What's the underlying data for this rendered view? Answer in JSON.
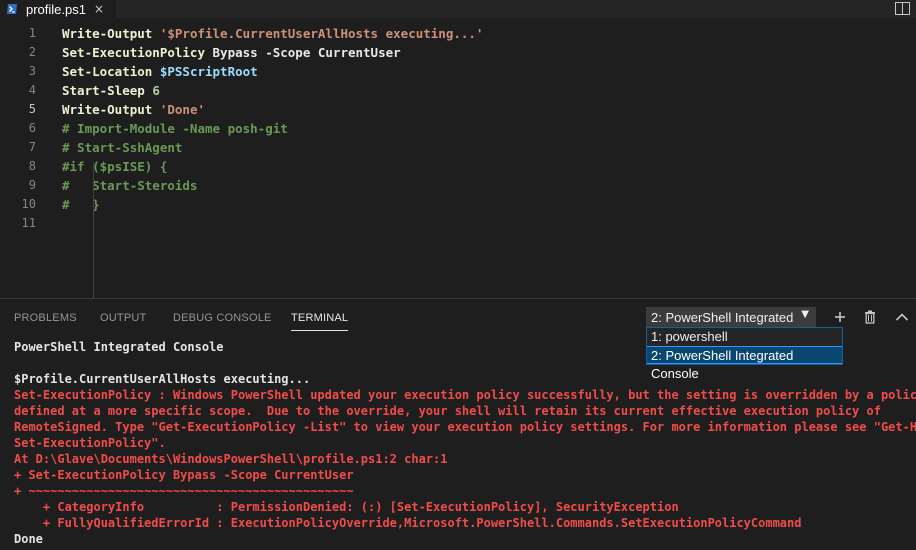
{
  "tab": {
    "filename": "profile.ps1",
    "close": "×"
  },
  "editor": {
    "lines": [
      {
        "num": "1",
        "tokens": [
          {
            "c": "cmd",
            "t": "Write-Output "
          },
          {
            "c": "str",
            "t": "'$Profile.CurrentUserAllHosts executing...'"
          }
        ]
      },
      {
        "num": "2",
        "tokens": [
          {
            "c": "cmd",
            "t": "Set-ExecutionPolicy "
          },
          {
            "c": "plain",
            "t": "Bypass -Scope CurrentUser"
          }
        ]
      },
      {
        "num": "3",
        "tokens": [
          {
            "c": "cmd",
            "t": "Set-Location "
          },
          {
            "c": "var",
            "t": "$PSScriptRoot"
          }
        ]
      },
      {
        "num": "4",
        "tokens": [
          {
            "c": "cmd",
            "t": "Start-Sleep "
          },
          {
            "c": "num",
            "t": "6"
          }
        ]
      },
      {
        "num": "5",
        "tokens": [
          {
            "c": "cmd",
            "t": "Write-Output "
          },
          {
            "c": "str",
            "t": "'Done'"
          }
        ]
      },
      {
        "num": "6",
        "tokens": [
          {
            "c": "cmt",
            "t": "# Import-Module -Name posh-git"
          }
        ]
      },
      {
        "num": "7",
        "tokens": [
          {
            "c": "cmt",
            "t": "# Start-SshAgent"
          }
        ]
      },
      {
        "num": "8",
        "tokens": [
          {
            "c": "cmt",
            "t": "#if ($psISE) {"
          }
        ]
      },
      {
        "num": "9",
        "tokens": [
          {
            "c": "cmt",
            "t": "#   Start-Steroids"
          }
        ]
      },
      {
        "num": "10",
        "tokens": [
          {
            "c": "cmt",
            "t": "#   }"
          }
        ]
      },
      {
        "num": "11",
        "tokens": []
      }
    ]
  },
  "panel": {
    "tabs": [
      "PROBLEMS",
      "OUTPUT",
      "DEBUG CONSOLE",
      "TERMINAL"
    ],
    "terminal_select": {
      "value": "2: PowerShell Integrated",
      "arrow": "▼"
    },
    "dropdown_options": [
      "1: powershell",
      "2: PowerShell Integrated Console"
    ],
    "terminal_lines": [
      {
        "c": "t-white",
        "t": "PowerShell Integrated Console"
      },
      {
        "c": "t-white",
        "t": ""
      },
      {
        "c": "t-white",
        "t": "$Profile.CurrentUserAllHosts executing..."
      },
      {
        "c": "t-red",
        "t": "Set-ExecutionPolicy : Windows PowerShell updated your execution policy successfully, but the setting is overridden by a policy"
      },
      {
        "c": "t-red",
        "t": "defined at a more specific scope.  Due to the override, your shell will retain its current effective execution policy of"
      },
      {
        "c": "t-red",
        "t": "RemoteSigned. Type \"Get-ExecutionPolicy -List\" to view your execution policy settings. For more information please see \"Get-Help"
      },
      {
        "c": "t-red",
        "t": "Set-ExecutionPolicy\"."
      },
      {
        "c": "t-red",
        "t": "At D:\\Glave\\Documents\\WindowsPowerShell\\profile.ps1:2 char:1"
      },
      {
        "c": "t-red",
        "t": "+ Set-ExecutionPolicy Bypass -Scope CurrentUser"
      },
      {
        "c": "t-red",
        "t": "+ ~~~~~~~~~~~~~~~~~~~~~~~~~~~~~~~~~~~~~~~~~~~~~"
      },
      {
        "c": "t-red",
        "t": "    + CategoryInfo          : PermissionDenied: (:) [Set-ExecutionPolicy], SecurityException"
      },
      {
        "c": "t-red",
        "t": "    + FullyQualifiedErrorId : ExecutionPolicyOverride,Microsoft.PowerShell.Commands.SetExecutionPolicyCommand"
      },
      {
        "c": "t-white",
        "t": "Done"
      }
    ]
  },
  "icons": {
    "tab": "powershell-icon",
    "editor_layout": "split-editor-icon",
    "add": "plus-icon",
    "kill": "trash-icon",
    "maximize": "chevron-up-icon"
  }
}
